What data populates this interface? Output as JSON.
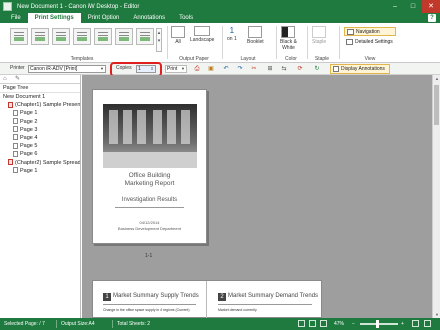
{
  "window": {
    "title": "New Document 1 - Canon iW Desktop - Editor",
    "minimize": "–",
    "maximize": "□",
    "close": "✕",
    "help": "?"
  },
  "menu": {
    "tabs": [
      "File",
      "Print Settings",
      "Print Option",
      "Annotations",
      "Tools"
    ],
    "active": "Print Settings"
  },
  "ribbon": {
    "templates_label": "Templates",
    "output_paper": {
      "label": "Output Paper",
      "all": "All",
      "landscape": "Landscape"
    },
    "layout": {
      "label": "Layout",
      "one_on": "1",
      "one_on_sub": "on 1",
      "booklet": "Booklet"
    },
    "color": {
      "label": "Color",
      "bw": "Black &",
      "bw_sub": "White"
    },
    "staple": {
      "label": "Staple",
      "staple": "Staple"
    },
    "view": {
      "label": "View",
      "navigation": "Navigation",
      "detailed": "Detailed Settings"
    }
  },
  "toolbar": {
    "printer_label": "Printer",
    "printer_value": "Canon iR-ADV [Print]",
    "copies_label": "Copies",
    "copies_value": "1",
    "print_button": "Print",
    "display_annotations": "Display Annotations"
  },
  "left_pane": {
    "title": "Page Tree",
    "tree": [
      {
        "label": "New Document 1",
        "level": 0,
        "kind": "doc"
      },
      {
        "label": "(Chapter1) Sample Presentation",
        "level": 1,
        "kind": "chapter"
      },
      {
        "label": "Page 1",
        "level": 2,
        "kind": "page"
      },
      {
        "label": "Page 2",
        "level": 2,
        "kind": "page"
      },
      {
        "label": "Page 3",
        "level": 2,
        "kind": "page"
      },
      {
        "label": "Page 4",
        "level": 2,
        "kind": "page"
      },
      {
        "label": "Page 5",
        "level": 2,
        "kind": "page"
      },
      {
        "label": "Page 6",
        "level": 2,
        "kind": "page"
      },
      {
        "label": "(Chapter2) Sample Spread Original",
        "level": 1,
        "kind": "chapter"
      },
      {
        "label": "Page 1",
        "level": 2,
        "kind": "page"
      }
    ]
  },
  "preview": {
    "page_title_1": "Office Building",
    "page_title_2": "Marketing Report",
    "page_subtitle": "Investigation Results",
    "page_date": "04/12/2014",
    "page_dept": "Business Development Department",
    "page_label": "1-1",
    "spread_left_num": "1",
    "spread_left_head": "Market Summary  Supply Trends",
    "spread_left_line": "Change in the office space supply in 4 regions (Current)",
    "spread_right_num": "2",
    "spread_right_head": "Market Summary  Demand Trends",
    "spread_right_line": "Market demand currently"
  },
  "status": {
    "selected_page": "Selected Page: / 7",
    "output_size": "Output Size:A4",
    "total_sheets": "Total Sheets: 2",
    "zoom": "47%"
  },
  "colors": {
    "brand_green": "#1f7a3f",
    "highlight_red": "#e02020",
    "active_yellow": "#fff5d6"
  }
}
